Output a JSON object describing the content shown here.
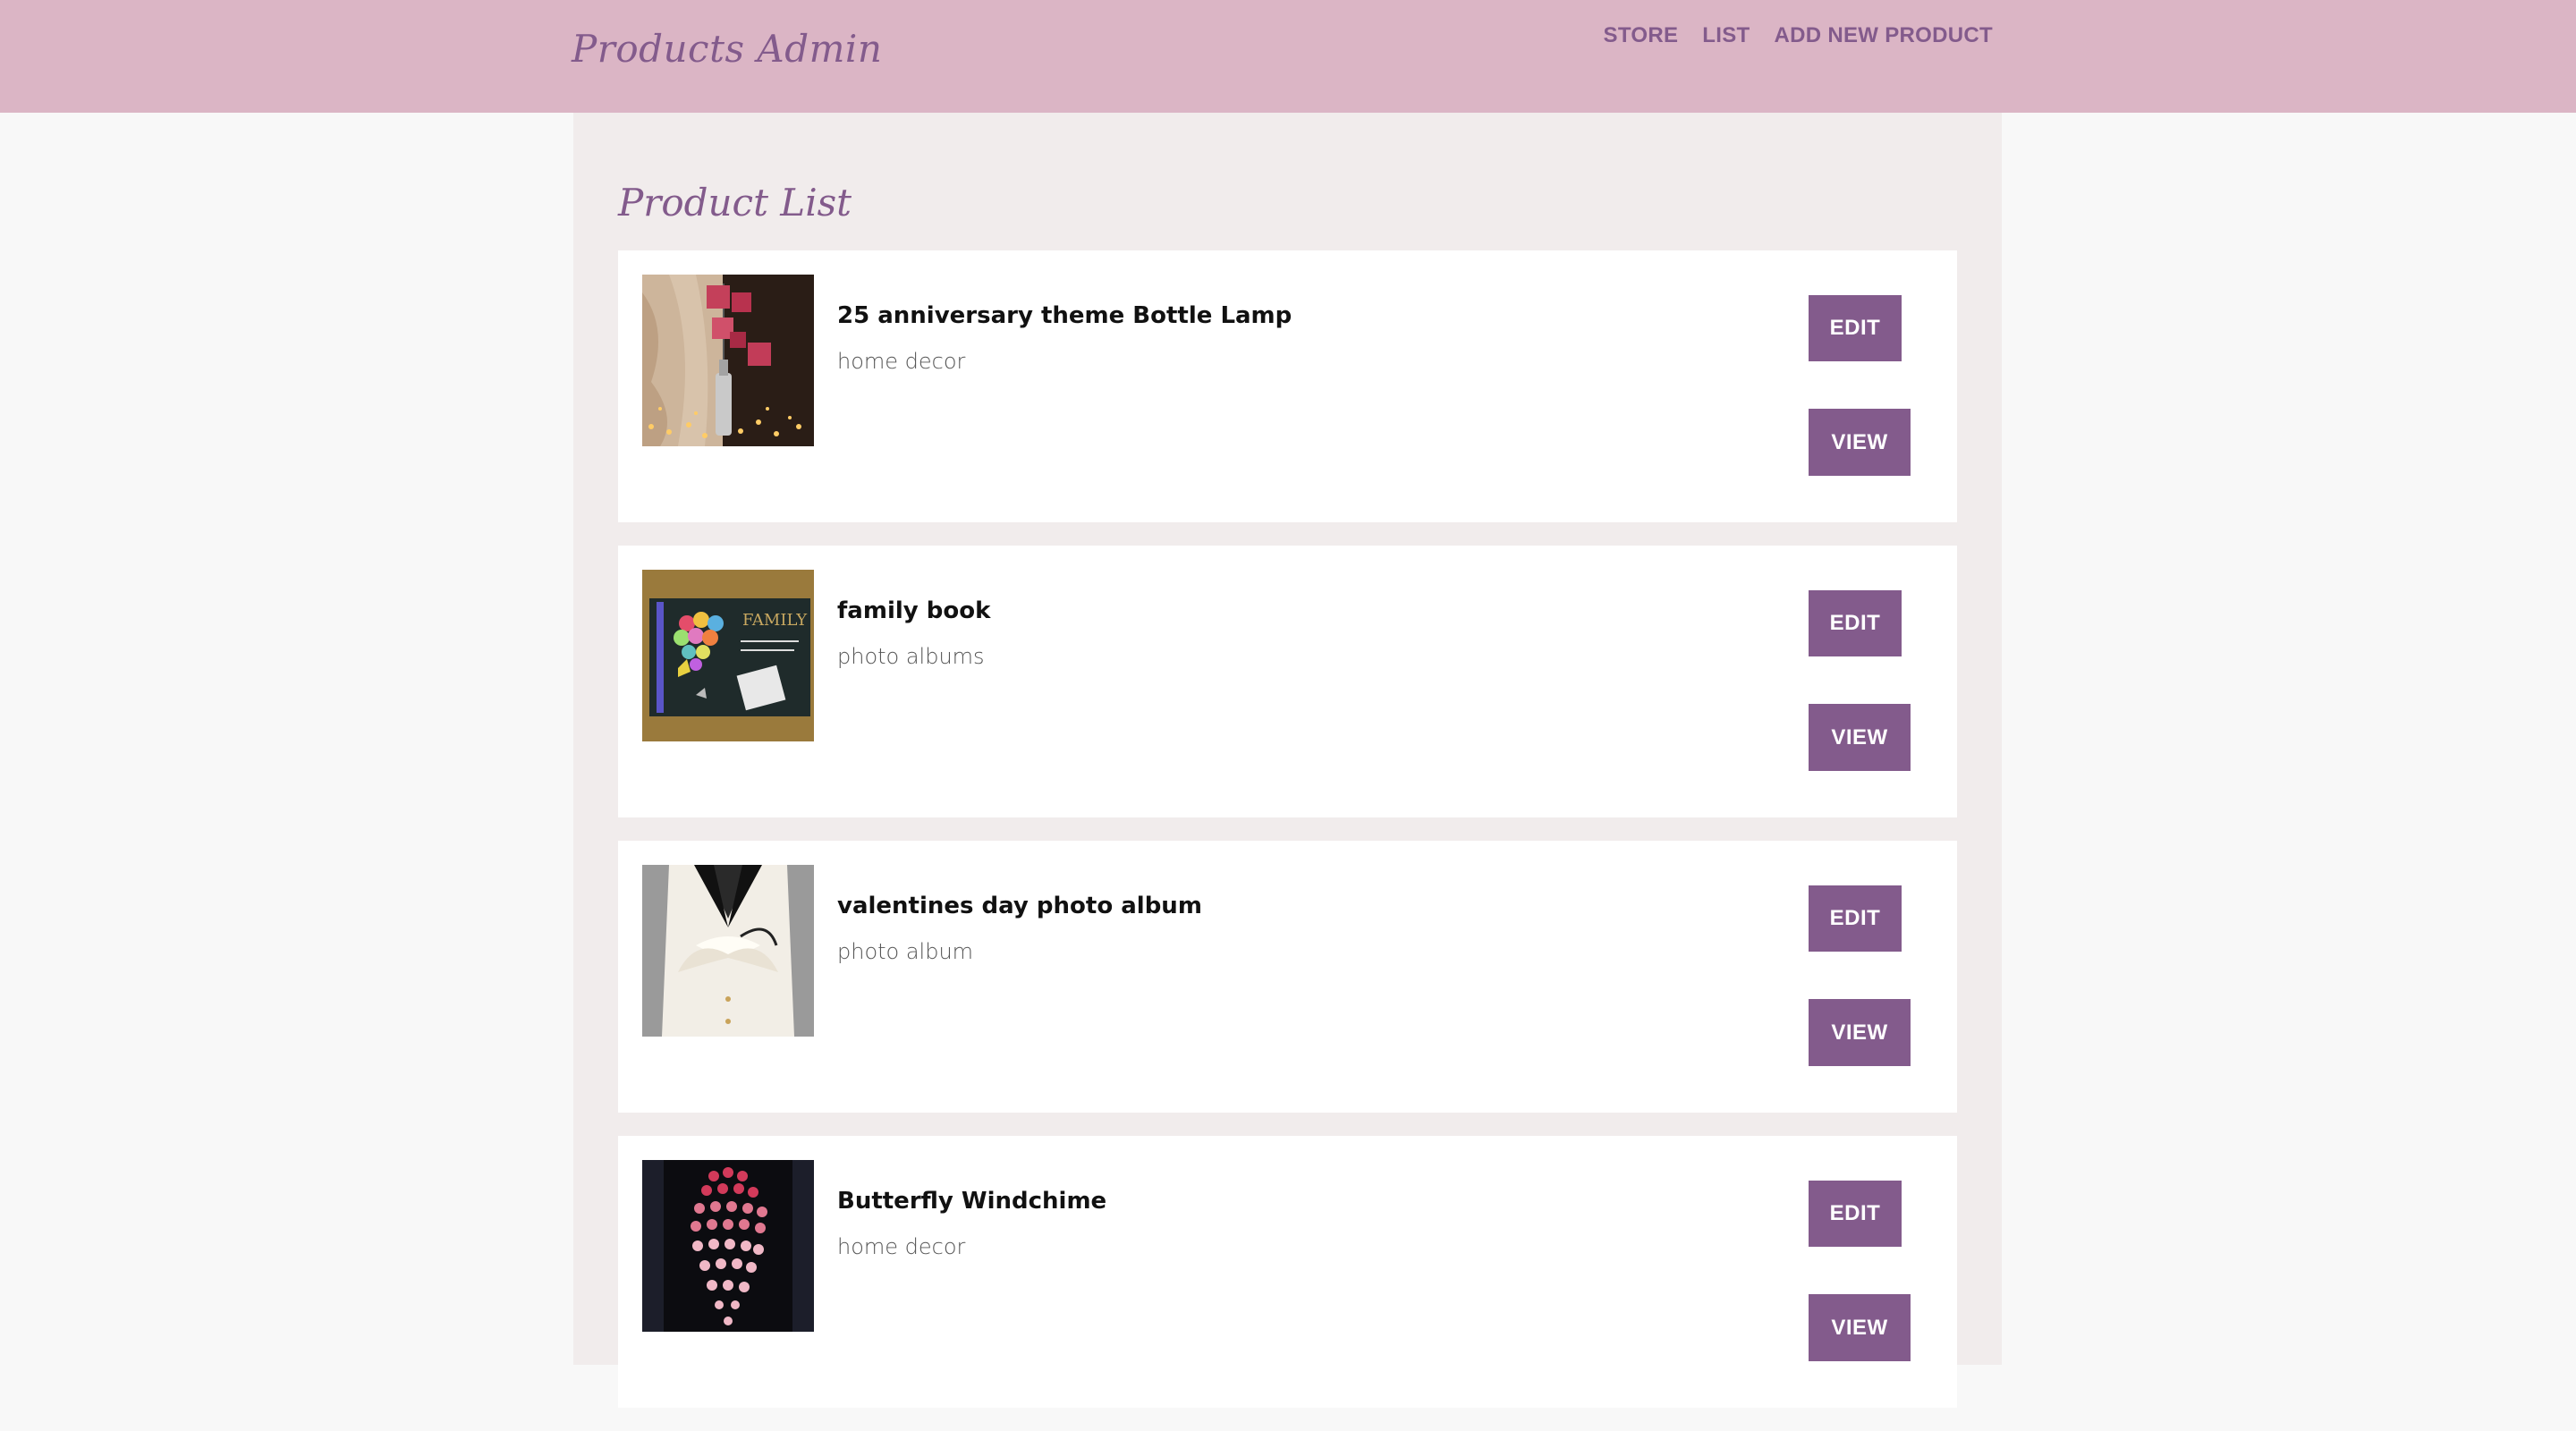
{
  "header": {
    "brand": "Products Admin",
    "nav": [
      "STORE",
      "LIST",
      "ADD NEW PRODUCT"
    ]
  },
  "main": {
    "title": "Product List",
    "products": [
      {
        "name": "25 anniversary theme Bottle Lamp",
        "category": "home decor",
        "edit_label": "EDIT",
        "view_label": "VIEW",
        "image": "bottle-lamp-photo"
      },
      {
        "name": "family book",
        "category": "photo albums",
        "edit_label": "EDIT",
        "view_label": "VIEW",
        "image": "family-book-photo"
      },
      {
        "name": "valentines day photo album",
        "category": "photo album",
        "edit_label": "EDIT",
        "view_label": "VIEW",
        "image": "tuxedo-album-photo"
      },
      {
        "name": "Butterfly Windchime",
        "category": "home decor",
        "edit_label": "EDIT",
        "view_label": "VIEW",
        "image": "butterfly-windchime-photo"
      }
    ]
  },
  "colors": {
    "header_bg": "#dbb5c5",
    "accent": "#835b8c",
    "panel_bg": "#f1ecec",
    "page_bg": "#f8f8f8"
  }
}
